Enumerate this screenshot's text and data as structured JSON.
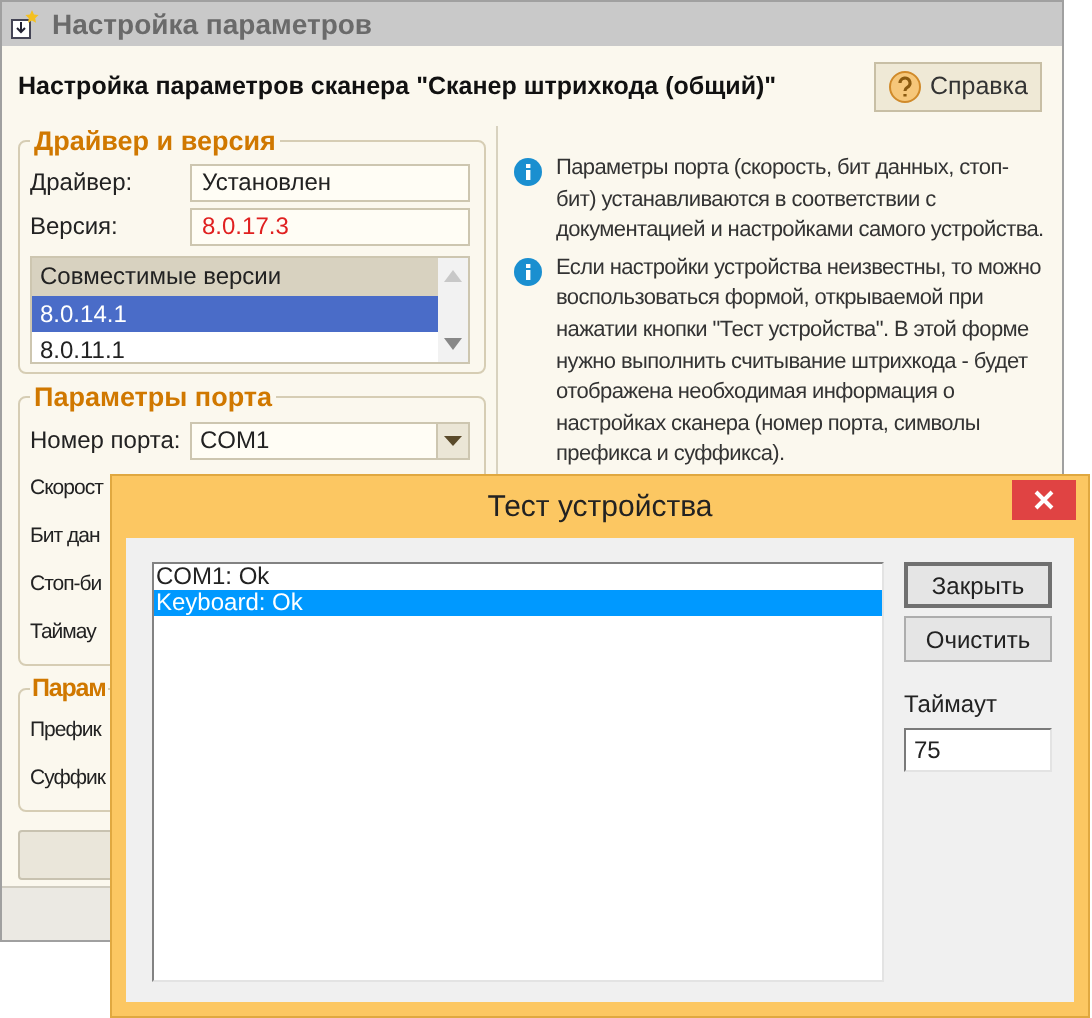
{
  "window": {
    "title": "Настройка параметров"
  },
  "header": {
    "title": "Настройка параметров сканера \"Сканер штрихкода (общий)\"",
    "help_button": "Справка"
  },
  "driver_group": {
    "legend": "Драйвер и версия",
    "fields": [
      {
        "label": "Драйвер:",
        "value": "Установлен",
        "kind": "text"
      },
      {
        "label": "Версия:",
        "value": "8.0.17.3",
        "kind": "warning"
      }
    ],
    "versions": {
      "column": "Совместимые версии",
      "rows": [
        {
          "text": "8.0.14.1",
          "selected": true
        },
        {
          "text": "8.0.11.1",
          "selected": false
        }
      ]
    }
  },
  "port_group": {
    "legend": "Параметры порта",
    "fields": [
      {
        "label": "Номер порта:",
        "value": "COM1",
        "kind": "combo"
      },
      {
        "label": "Скорост",
        "kind": "covered"
      },
      {
        "label": "Бит дан",
        "kind": "covered"
      },
      {
        "label": "Стоп-би",
        "kind": "covered"
      },
      {
        "label": "Таймау",
        "kind": "covered"
      }
    ]
  },
  "prefix_group": {
    "legend": "Парам",
    "fields": [
      {
        "label": "Префик",
        "kind": "covered"
      },
      {
        "label": "Суффик",
        "kind": "covered"
      }
    ]
  },
  "info": [
    "Параметры порта (скорость, бит данных, стоп-бит) устанавливаются в соответствии с документацией и настройками самого устройства.",
    "Если настройки устройства неизвестны, то можно воспользоваться формой, открываемой при нажатии кнопки \"Тест устройства\". В этой форме нужно выполнить считывание штрихкода - будет отображена необходимая информация о настройках сканера (номер порта, символы префикса и суффикса)."
  ],
  "dialog": {
    "title": "Тест устройства",
    "log": [
      {
        "text": "COM1: Ok",
        "selected": false
      },
      {
        "text": "Keyboard: Ok",
        "selected": true
      }
    ],
    "buttons": [
      "Закрыть",
      "Очистить"
    ],
    "timeout_label": "Таймаут",
    "timeout_value": "75"
  }
}
